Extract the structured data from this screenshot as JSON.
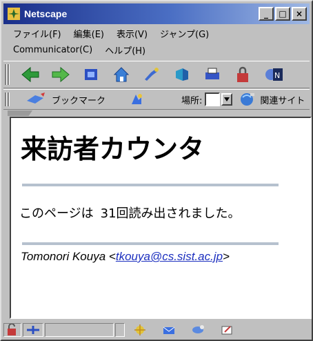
{
  "window": {
    "title": "Netscape",
    "minimize": "_",
    "maximize": "□",
    "close": "×"
  },
  "menu": {
    "row1": [
      "ファイル(F)",
      "編集(E)",
      "表示(V)",
      "ジャンプ(G)"
    ],
    "row2": [
      "Communicator(C)",
      "ヘルプ(H)"
    ]
  },
  "nav_toolbar": {
    "icons": [
      "back-icon",
      "forward-icon",
      "reload-icon",
      "home-icon",
      "search-icon",
      "guide-icon",
      "print-icon",
      "security-icon",
      "stop-icon"
    ]
  },
  "location_toolbar": {
    "bookmarks_label": "ブックマーク",
    "location_label": "場所:",
    "location_value": "",
    "related_label": "関連サイト"
  },
  "page": {
    "title": "来訪者カウンタ",
    "counter_prefix": "このページは",
    "counter_value": "31回読み出されました。",
    "author": "Tomonori Kouya",
    "email_open": "<",
    "email": "tkouya@cs.sist.ac.jp",
    "email_close": ">"
  },
  "colors": {
    "titlebar_start": "#1a2f8a",
    "link": "#1c2fbf",
    "hr": "#b6c1ce"
  }
}
